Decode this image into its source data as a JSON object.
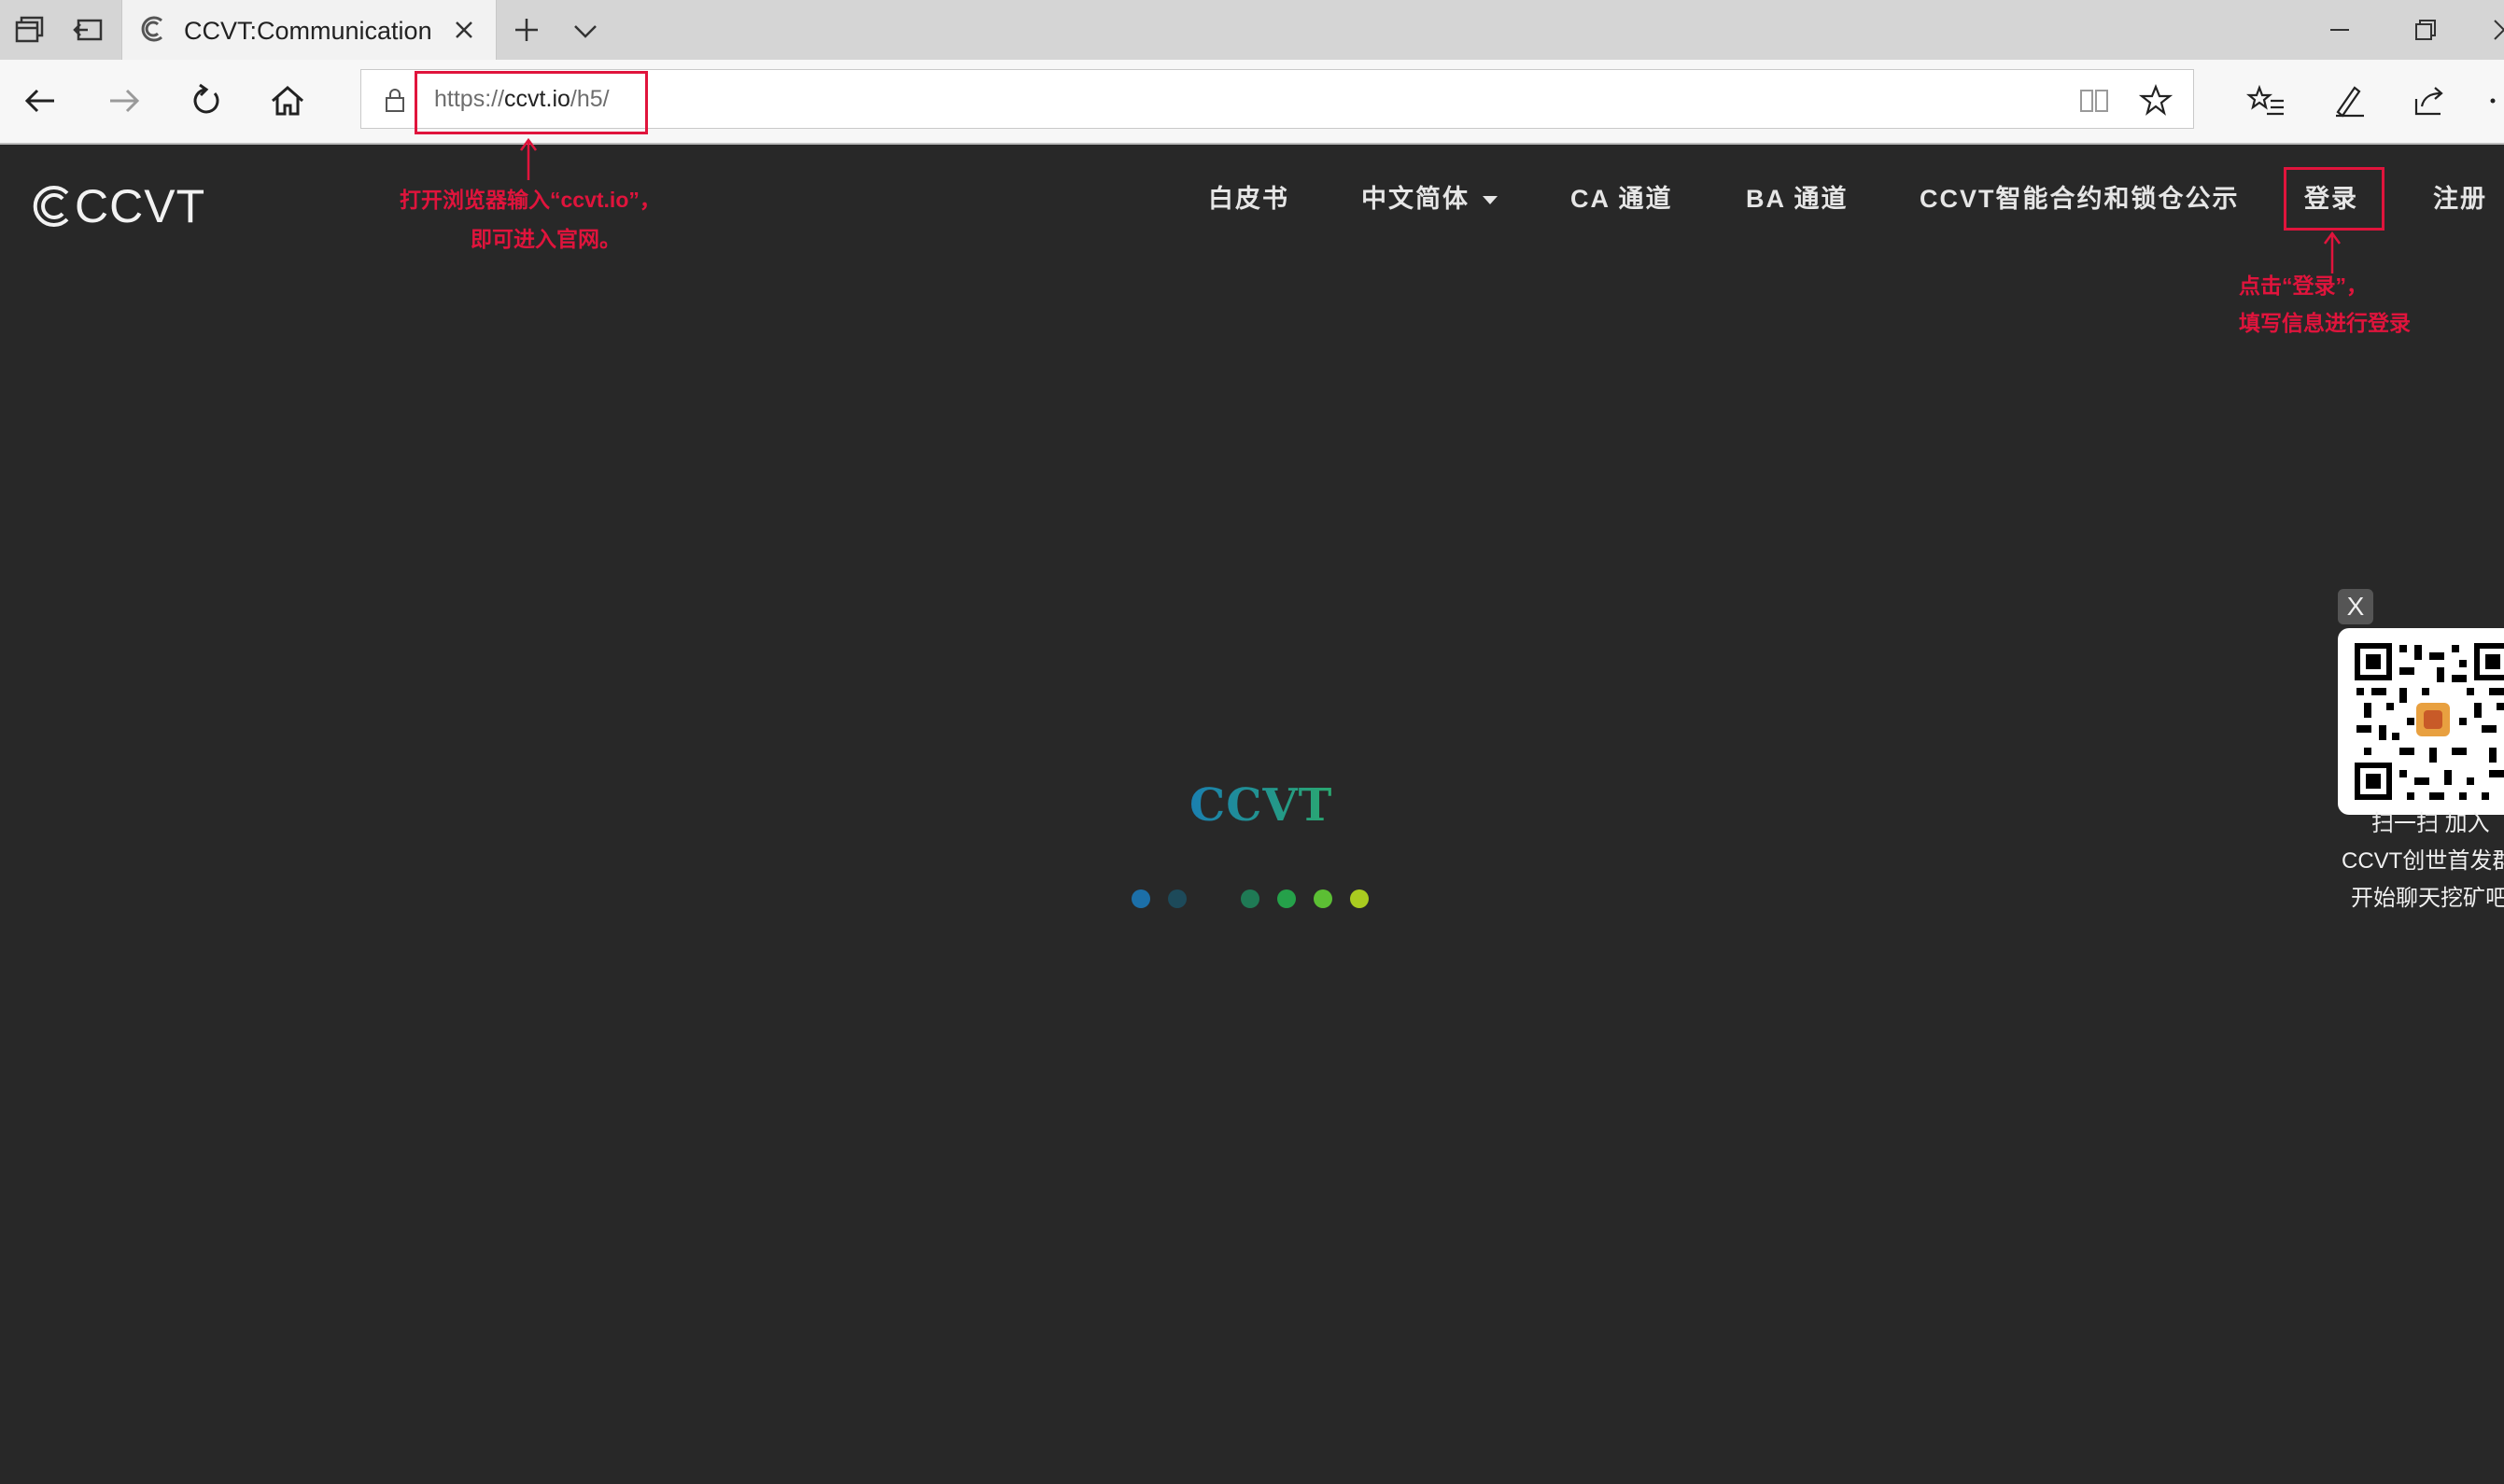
{
  "browser": {
    "tab_title": "CCVT:Communication c",
    "url_scheme": "https://",
    "url_host": "ccvt.io",
    "url_path": "/h5/"
  },
  "site": {
    "logo_text": "CCVT",
    "menu": [
      {
        "label": "白皮书"
      },
      {
        "label": "中文简体"
      },
      {
        "label": "CA 通道"
      },
      {
        "label": "BA 通道"
      },
      {
        "label": "CCVT智能合约和锁仓公示"
      },
      {
        "label": "登录"
      },
      {
        "label": "注册"
      }
    ]
  },
  "annotations": {
    "url_note_line1": "打开浏览器输入“ccvt.io”，",
    "url_note_line2": "即可进入官网。",
    "login_note_line1": "点击“登录”，",
    "login_note_line2": "填写信息进行登录"
  },
  "loader": {
    "title": "CCVT",
    "dot_colors": [
      "#1c6fa8",
      "#1d4a5a",
      "#282828",
      "#1f7a55",
      "#25a14a",
      "#5cbf34",
      "#a9cc20"
    ]
  },
  "qr_widget": {
    "close_label": "X",
    "line1": "扫一扫 加入",
    "line2": "CCVT创世首发群",
    "line3": "开始聊天挖矿吧"
  },
  "colors": {
    "annotation_red": "#e0143c",
    "page_bg": "#282828"
  }
}
